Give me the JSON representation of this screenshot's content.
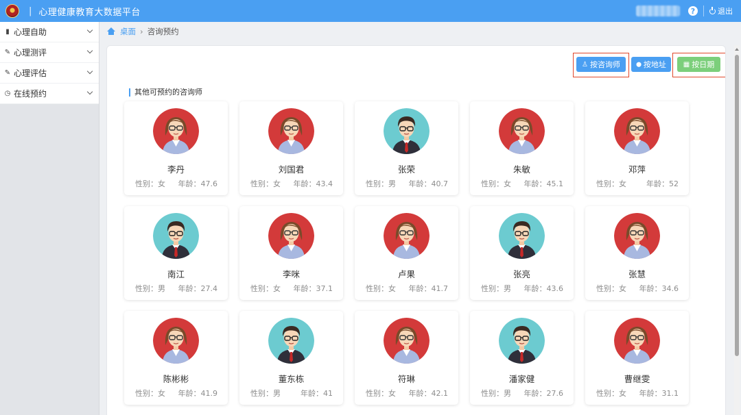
{
  "header": {
    "separator": "|",
    "title": "心理健康教育大数据平台",
    "help_glyph": "?",
    "logout_label": "退出"
  },
  "sidebar": {
    "items": [
      {
        "label": "心理自助",
        "icon": "book-icon",
        "glyph": "▮"
      },
      {
        "label": "心理测评",
        "icon": "edit-icon",
        "glyph": "✎"
      },
      {
        "label": "心理评估",
        "icon": "edit-icon",
        "glyph": "✎"
      },
      {
        "label": "在线预约",
        "icon": "clock-icon",
        "glyph": "◷"
      }
    ]
  },
  "breadcrumb": {
    "home": "桌面",
    "separator": "›",
    "current": "咨询预约"
  },
  "toolbar": {
    "by_counselor": "按咨询师",
    "by_address": "按地址",
    "by_date": "按日期",
    "counselor_glyph": "♙",
    "address_glyph": "⬤",
    "date_glyph": "▦"
  },
  "section_title": "其他可预约的咨询师",
  "labels": {
    "gender_prefix": "性别：",
    "age_prefix": "年龄："
  },
  "colors": {
    "primary": "#4a9ff2",
    "green": "#7ccf7b",
    "highlight": "#e0472b",
    "female_avatar_bg": "#d33a3a",
    "male_avatar_bg": "#6ccbd0"
  },
  "counselors": [
    {
      "name": "李丹",
      "gender": "女",
      "age": "47.6"
    },
    {
      "name": "刘国君",
      "gender": "女",
      "age": "43.4"
    },
    {
      "name": "张荣",
      "gender": "男",
      "age": "40.7"
    },
    {
      "name": "朱敏",
      "gender": "女",
      "age": "45.1"
    },
    {
      "name": "邓萍",
      "gender": "女",
      "age": "52"
    },
    {
      "name": "南江",
      "gender": "男",
      "age": "27.4"
    },
    {
      "name": "李咪",
      "gender": "女",
      "age": "37.1"
    },
    {
      "name": "卢果",
      "gender": "女",
      "age": "41.7"
    },
    {
      "name": "张亮",
      "gender": "男",
      "age": "43.6"
    },
    {
      "name": "张慧",
      "gender": "女",
      "age": "34.6"
    },
    {
      "name": "陈彬彬",
      "gender": "女",
      "age": "41.9"
    },
    {
      "name": "董东栋",
      "gender": "男",
      "age": "41"
    },
    {
      "name": "符琳",
      "gender": "女",
      "age": "42.1"
    },
    {
      "name": "潘家健",
      "gender": "男",
      "age": "27.6"
    },
    {
      "name": "曹继雯",
      "gender": "女",
      "age": "31.1"
    }
  ]
}
